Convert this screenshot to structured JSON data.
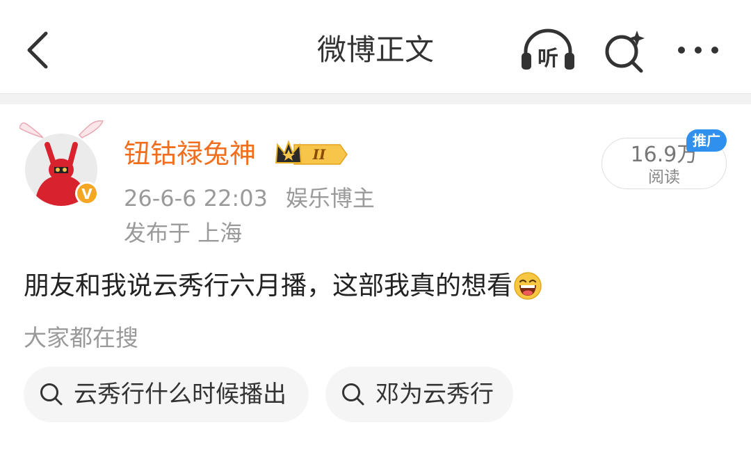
{
  "header": {
    "title": "微博正文",
    "listen_label": "听",
    "icons": {
      "back": "back-arrow-icon",
      "listen": "headphones-icon",
      "search": "ai-search-icon",
      "more": "more-icon"
    }
  },
  "post": {
    "author": "钮钴禄兔神",
    "member_badge_text": "II",
    "verified_badge": "V",
    "time": "26-6-6 22:03",
    "author_role": "娱乐博主",
    "location": "发布于 上海",
    "reads": {
      "count": "16.9万",
      "label": "阅读"
    },
    "promo_badge": "推广",
    "content": "朋友和我说云秀行六月播，这部我真的想看",
    "content_emoji": "laughing-face-emoji"
  },
  "related_search": {
    "title": "大家都在搜",
    "items": [
      {
        "label": "云秀行什么时候播出"
      },
      {
        "label": "邓为云秀行"
      }
    ]
  },
  "colors": {
    "author_name": "#f06e1e",
    "promo": "#2f90ee",
    "verified": "#f5a623",
    "meta": "#9a9a9a"
  }
}
